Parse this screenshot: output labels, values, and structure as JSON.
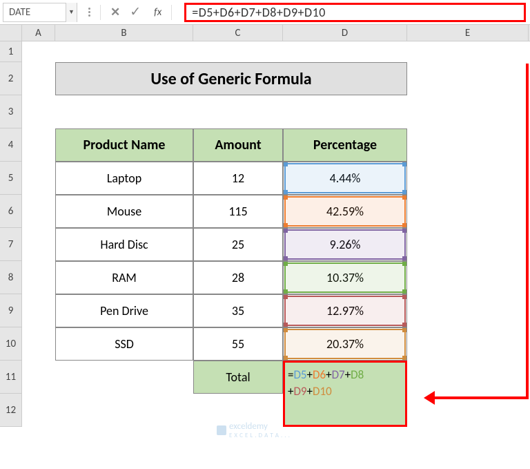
{
  "nameBox": "DATE",
  "formulaBar": "=D5+D6+D7+D8+D9+D10",
  "fxLabel": "fx",
  "columns": [
    "A",
    "B",
    "C",
    "D",
    "E"
  ],
  "rows": [
    "1",
    "2",
    "3",
    "4",
    "5",
    "6",
    "7",
    "8",
    "9",
    "10",
    "11",
    "12"
  ],
  "title": "Use of Generic Formula",
  "headers": {
    "b": "Product Name",
    "c": "Amount",
    "d": "Percentage"
  },
  "data": [
    {
      "name": "Laptop",
      "amount": "12",
      "pct": "4.44%"
    },
    {
      "name": "Mouse",
      "amount": "115",
      "pct": "42.59%"
    },
    {
      "name": "Hard Disc",
      "amount": "25",
      "pct": "9.26%"
    },
    {
      "name": "RAM",
      "amount": "28",
      "pct": "10.37%"
    },
    {
      "name": "Pen Drive",
      "amount": "35",
      "pct": "12.97%"
    },
    {
      "name": "SSD",
      "amount": "55",
      "pct": "20.37%"
    }
  ],
  "totalLabel": "Total",
  "formulaCell": {
    "prefix": "=",
    "refs": [
      "D5",
      "D6",
      "D7",
      "D8",
      "D9",
      "D10"
    ]
  },
  "watermark": {
    "brand": "exceldemy",
    "sub": "E X C E L . D A T A . . ."
  }
}
